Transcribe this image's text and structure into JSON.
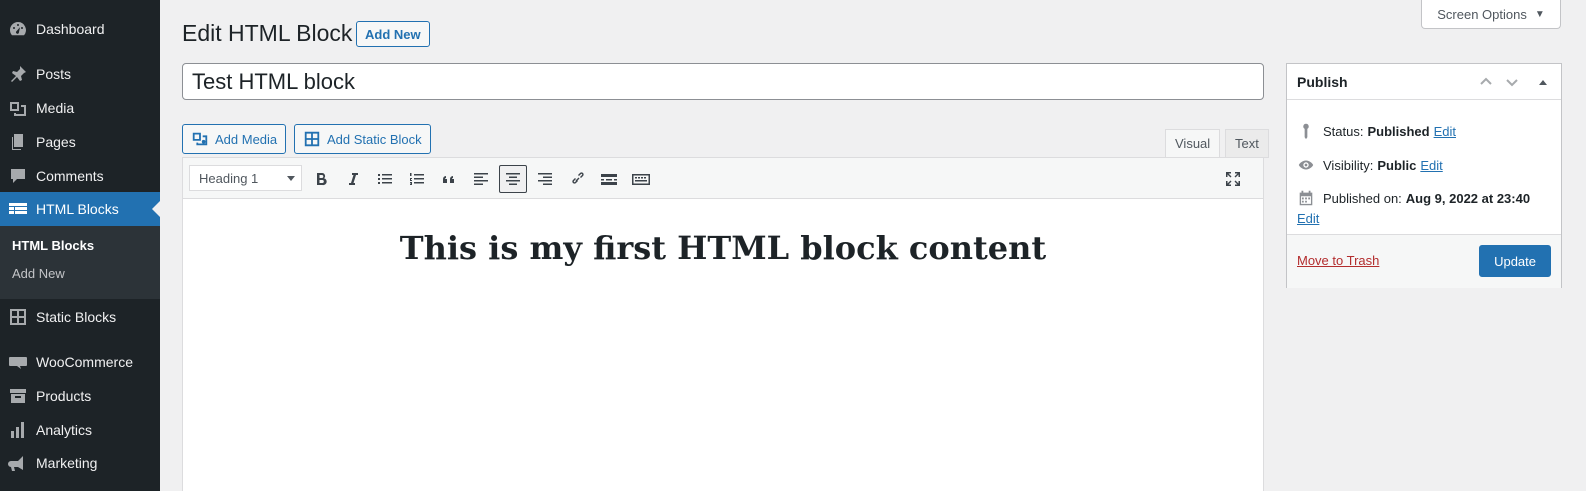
{
  "sidebar": {
    "items": [
      {
        "label": "Dashboard",
        "icon": "dashboard-icon"
      },
      {
        "label": "Posts",
        "icon": "pin-icon"
      },
      {
        "label": "Media",
        "icon": "media-icon"
      },
      {
        "label": "Pages",
        "icon": "pages-icon"
      },
      {
        "label": "Comments",
        "icon": "comment-icon"
      },
      {
        "label": "HTML Blocks",
        "icon": "table-icon",
        "active": true
      },
      {
        "label": "Static Blocks",
        "icon": "grid-icon"
      },
      {
        "label": "WooCommerce",
        "icon": "woo-icon"
      },
      {
        "label": "Products",
        "icon": "archive-icon"
      },
      {
        "label": "Analytics",
        "icon": "chart-bar-icon"
      },
      {
        "label": "Marketing",
        "icon": "megaphone-icon"
      }
    ],
    "submenu": [
      {
        "label": "HTML Blocks",
        "current": true
      },
      {
        "label": "Add New",
        "current": false
      }
    ]
  },
  "header": {
    "title": "Edit HTML Block",
    "add_new_label": "Add New",
    "screen_options_label": "Screen Options",
    "screen_options_caret": "▼"
  },
  "post": {
    "title_value": "Test HTML block"
  },
  "media_buttons": {
    "add_media": "Add Media",
    "add_static_block": "Add Static Block"
  },
  "editor": {
    "tabs": {
      "visual": "Visual",
      "text": "Text"
    },
    "active_tab": "Visual",
    "format_select_value": "Heading 1",
    "content_heading": "This is my first HTML block content",
    "toolbar_icons": [
      "bold-icon",
      "italic-icon",
      "bullet-list-icon",
      "numbered-list-icon",
      "blockquote-icon",
      "align-left-icon",
      "align-center-icon",
      "align-right-icon",
      "link-icon",
      "read-more-icon",
      "toolbar-toggle-icon",
      "fullscreen-icon"
    ],
    "pressed_button": "align-center-icon"
  },
  "publish": {
    "title": "Publish",
    "status_label": "Status:",
    "status_value": "Published",
    "visibility_label": "Visibility:",
    "visibility_value": "Public",
    "published_on_label": "Published on:",
    "published_on_value": "Aug 9, 2022 at 23:40",
    "edit_label": "Edit",
    "trash_label": "Move to Trash",
    "update_label": "Update"
  },
  "colors": {
    "accent": "#2271b1",
    "sidebar_bg": "#1d2327",
    "trash": "#b32d2e"
  }
}
